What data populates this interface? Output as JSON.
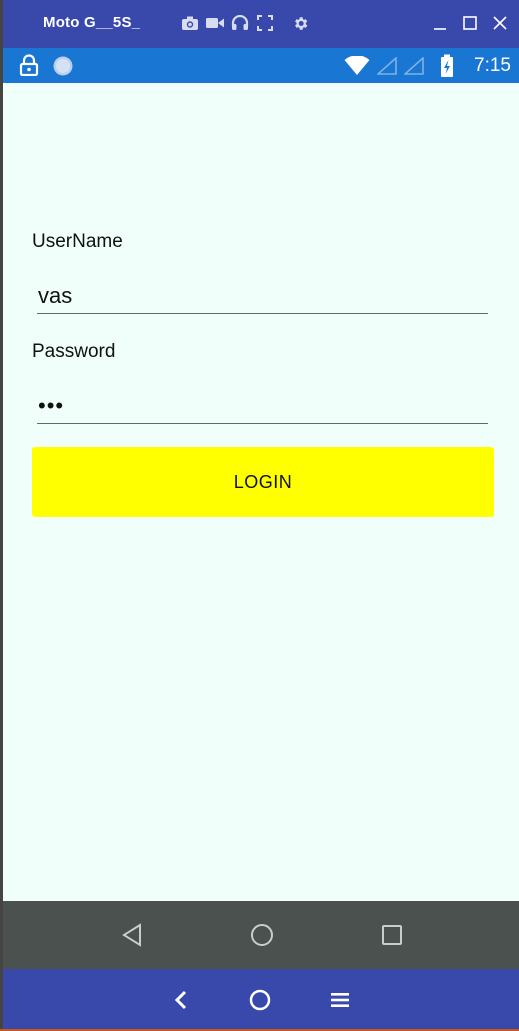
{
  "emulator": {
    "title": "Moto G__5S_",
    "tools": [
      "camera-icon",
      "video-icon",
      "headphones-icon",
      "fullscreen-icon",
      "gear-icon"
    ],
    "window_controls": [
      "minimize-icon",
      "maximize-icon",
      "close-icon"
    ]
  },
  "status_bar": {
    "time": "7:15",
    "icons": [
      "lock-icon",
      "circle-icon",
      "wifi-icon",
      "signal-icon",
      "signal-icon",
      "battery-charging-icon"
    ]
  },
  "form": {
    "username_label": "UserName",
    "username_value": "vas",
    "password_label": "Password",
    "password_value": "•••",
    "login_label": "LOGIN"
  },
  "nav_bar": {
    "buttons": [
      "back-icon",
      "home-icon",
      "recents-icon"
    ]
  },
  "emulator_bottom": {
    "buttons": [
      "chevron-left-icon",
      "circle-home-icon",
      "menu-icon"
    ]
  },
  "colors": {
    "emulator_bar": "#3949ab",
    "status_bar": "#1976d2",
    "content_background": "#f0fff9",
    "login_button": "#ffff00",
    "nav_bar": "#4a514e"
  }
}
